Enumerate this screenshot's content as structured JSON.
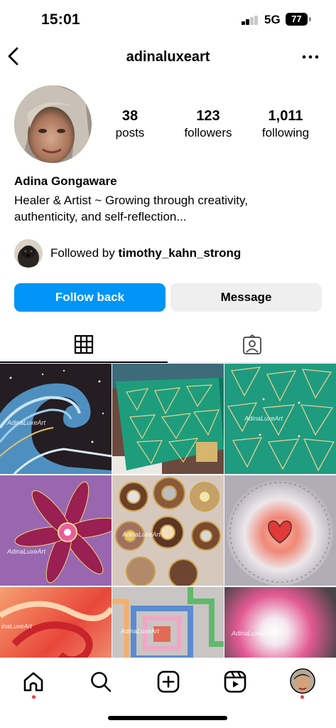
{
  "status_bar": {
    "time": "15:01",
    "network": "5G",
    "battery": "77"
  },
  "header": {
    "username": "adinaluxeart",
    "back_icon": "chevron-left-icon",
    "more_icon": "more-horizontal-icon"
  },
  "profile": {
    "stats": [
      {
        "count": "38",
        "label": "posts"
      },
      {
        "count": "123",
        "label": "followers"
      },
      {
        "count": "1,011",
        "label": "following"
      }
    ],
    "full_name": "Adina Gongaware",
    "bio_line1": "Healer & Artist ~ Growing through creativity,",
    "bio_line2": "authenticity, and self-reflection...",
    "followed_by_prefix": "Followed by ",
    "followed_by_user": "timothy_kahn_strong"
  },
  "buttons": {
    "follow_back": "Follow back",
    "message": "Message"
  },
  "tabs": [
    {
      "icon": "grid-icon",
      "active": true
    },
    {
      "icon": "tagged-person-icon",
      "active": false
    }
  ],
  "grid": {
    "watermark": "AdinaLuxeArt",
    "watermark_clipped": "inaLuxeArt",
    "posts": [
      {
        "subject": "wave painting",
        "accent": "#7fb7d6"
      },
      {
        "subject": "green triangle canvas",
        "accent": "#1f9c7c"
      },
      {
        "subject": "green triangle pattern",
        "accent": "#26a184"
      },
      {
        "subject": "magenta mandala flower",
        "accent": "#b0306e"
      },
      {
        "subject": "gem mosaic",
        "accent": "#8a6a48"
      },
      {
        "subject": "heart in light",
        "accent": "#f08878"
      },
      {
        "subject": "red swirl",
        "accent": "#e8473a"
      },
      {
        "subject": "geometric pastel maze",
        "accent": "#5b8bd0"
      },
      {
        "subject": "pink light burst",
        "accent": "#e35a94"
      }
    ]
  },
  "bottom_nav": [
    {
      "icon": "home-icon"
    },
    {
      "icon": "search-icon"
    },
    {
      "icon": "create-post-icon"
    },
    {
      "icon": "reels-icon"
    },
    {
      "icon": "profile-avatar-icon"
    }
  ],
  "colors": {
    "primary_button": "#0095f6",
    "secondary_button": "#efefef",
    "notification_dot": "#ff3040"
  }
}
